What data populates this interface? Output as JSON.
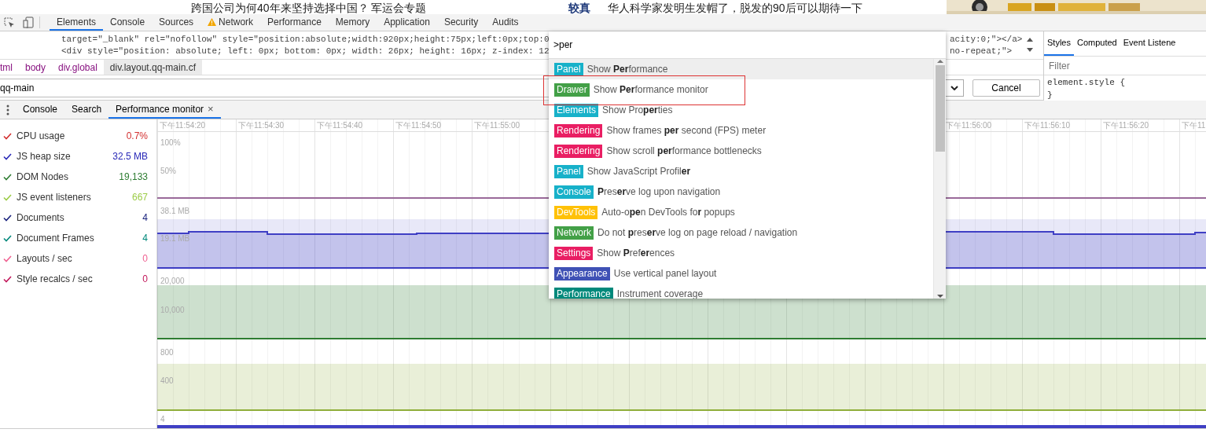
{
  "page_strip": {
    "headline": "跨国公司为何40年来坚持选择中国？ 军运会专题",
    "tag": "较真",
    "headline_2": "华人科学家发明生发帽了，脱发的90后可以期待一下"
  },
  "devtools_tabs": [
    {
      "label": "Elements",
      "selected": true,
      "warning": false
    },
    {
      "label": "Console",
      "selected": false,
      "warning": false
    },
    {
      "label": "Sources",
      "selected": false,
      "warning": false
    },
    {
      "label": "Network",
      "selected": false,
      "warning": true
    },
    {
      "label": "Performance",
      "selected": false,
      "warning": false
    },
    {
      "label": "Memory",
      "selected": false,
      "warning": false
    },
    {
      "label": "Application",
      "selected": false,
      "warning": false
    },
    {
      "label": "Security",
      "selected": false,
      "warning": false
    },
    {
      "label": "Audits",
      "selected": false,
      "warning": false
    }
  ],
  "code_lines": [
    {
      "left": "target=\"_blank\" rel=\"nofollow\" style=\"position:absolute;width:920px;height:75px;left:0px;top:0",
      "right": "acity:0;\"></a>"
    },
    {
      "left": "<div style=\"position: absolute; left: 0px; bottom: 0px; width: 26px; height: 16px; z-index: 12",
      "right": "no-repeat;\">"
    }
  ],
  "breadcrumbs": [
    {
      "label": "tml",
      "selected": false
    },
    {
      "label": "body",
      "selected": false
    },
    {
      "label": "div.global",
      "selected": false
    },
    {
      "label": "div.layout.qq-main.cf",
      "selected": true
    }
  ],
  "search": {
    "value": "qq-main",
    "cancel": "Cancel"
  },
  "styles_pane": {
    "tabs": [
      {
        "label": "Styles",
        "selected": true
      },
      {
        "label": "Computed",
        "selected": false
      },
      {
        "label": "Event Listene",
        "selected": false
      }
    ],
    "filter_placeholder": "Filter",
    "rule_lines": [
      "element.style {",
      "}"
    ]
  },
  "drawer_tabs": [
    {
      "label": "Console",
      "selected": false
    },
    {
      "label": "Search",
      "selected": false
    },
    {
      "label": "Performance monitor",
      "selected": true,
      "close": "×"
    }
  ],
  "metrics": [
    {
      "name": "CPU usage",
      "value": "0.7%",
      "color": "#d32f2f",
      "checked": true
    },
    {
      "name": "JS heap size",
      "value": "32.5 MB",
      "color": "#2a2ab8",
      "checked": true
    },
    {
      "name": "DOM Nodes",
      "value": "19,133",
      "color": "#2e7d32",
      "checked": true
    },
    {
      "name": "JS event listeners",
      "value": "667",
      "color": "#9ccc47",
      "checked": true
    },
    {
      "name": "Documents",
      "value": "4",
      "color": "#1a237e",
      "checked": true
    },
    {
      "name": "Document Frames",
      "value": "4",
      "color": "#00897b",
      "checked": true
    },
    {
      "name": "Layouts / sec",
      "value": "0",
      "color": "#f06292",
      "checked": true
    },
    {
      "name": "Style recalcs / sec",
      "value": "0",
      "color": "#c2185b",
      "checked": true
    }
  ],
  "timeline": {
    "left_times": [
      "下午11:54:20",
      "下午11:54:30",
      "下午11:54:40",
      "下午11:54:50",
      "下午11:55:00"
    ],
    "right_times": [
      "下午11:56:00",
      "下午11:56:10",
      "下午11:56:20",
      "下午11"
    ]
  },
  "graphs": [
    {
      "kind": "cpu",
      "color": "#9a6a9a",
      "labels": [
        "100%",
        "50%"
      ]
    },
    {
      "kind": "heap",
      "color": "#3f3fc4",
      "labels": [
        "38.1 MB",
        "19.1 MB"
      ]
    },
    {
      "kind": "dom",
      "color": "#2e7d32",
      "labels": [
        "20,000",
        "10,000"
      ]
    },
    {
      "kind": "listeners",
      "color": "#8fae3a",
      "labels": [
        "800",
        "400"
      ]
    },
    {
      "kind": "documents",
      "color": "#3f3fc4",
      "labels": [
        "4"
      ]
    }
  ],
  "command_menu": {
    "query": ">per",
    "items": [
      {
        "category": "Panel",
        "color": "#17b1c9",
        "title": "Show **Per**formance",
        "selected": true,
        "outlined": false
      },
      {
        "category": "Drawer",
        "color": "#43a047",
        "title": "Show **Per**formance monitor",
        "selected": false,
        "outlined": true
      },
      {
        "category": "Elements",
        "color": "#17b1c9",
        "title": "Show Pro**per**ties",
        "selected": false,
        "outlined": false
      },
      {
        "category": "Rendering",
        "color": "#e91e63",
        "title": "Show frames **per** second (FPS) meter",
        "selected": false,
        "outlined": false
      },
      {
        "category": "Rendering",
        "color": "#e91e63",
        "title": "Show scroll **per**formance bottlenecks",
        "selected": false,
        "outlined": false
      },
      {
        "category": "Panel",
        "color": "#17b1c9",
        "title": "Show JavaScript Profil**er**",
        "selected": false,
        "outlined": false
      },
      {
        "category": "Console",
        "color": "#17b1c9",
        "title": "**P**res**er**ve log upon navigation",
        "selected": false,
        "outlined": false
      },
      {
        "category": "DevTools",
        "color": "#ffc107",
        "title": "Auto-o**pe**n DevTools fo**r** popups",
        "selected": false,
        "outlined": false
      },
      {
        "category": "Network",
        "color": "#43a047",
        "title": "Do not **p**res**er**ve log on page reload / navigation",
        "selected": false,
        "outlined": false
      },
      {
        "category": "Settings",
        "color": "#e91e63",
        "title": "Show **P**ref**er**ences",
        "selected": false,
        "outlined": false
      },
      {
        "category": "Appearance",
        "color": "#3f51b5",
        "title": "Use vertical panel layout",
        "selected": false,
        "outlined": false
      },
      {
        "category": "Performance",
        "color": "#00897b",
        "title": "Instrument coverage",
        "selected": false,
        "outlined": false
      }
    ]
  }
}
